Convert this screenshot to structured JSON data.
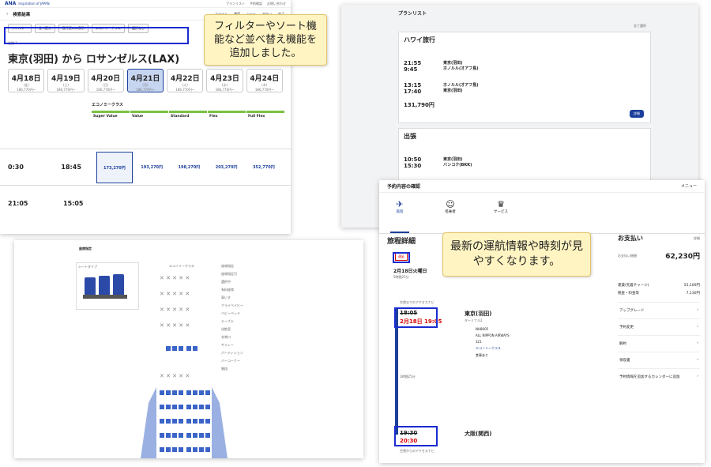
{
  "callouts": {
    "top": "フィルターやソート機能など並べ替え機能を追加しました。",
    "right": "最新の運航情報や時刻が見やすくなります。"
  },
  "search": {
    "brand": "ANA",
    "tagline": "Inspiration of JAPAN",
    "header_links": [
      "プランリスト",
      "予約確認",
      "お問い合わせ"
    ],
    "title": "検索結果",
    "steps": [
      "フライト",
      "運賃",
      "シート",
      "支払い",
      "完了"
    ],
    "filters": [
      "フィルター",
      "並べ替え",
      "直行便のみ表示",
      "エコノミークラス",
      "選択なし"
    ],
    "outbound": "往路 1",
    "route": "東京(羽田) から ロサンゼルス(LAX)",
    "dates": [
      {
        "date": "4月18日",
        "dow": "(金)",
        "price": "186,770円~"
      },
      {
        "date": "4月19日",
        "dow": "(土)",
        "price": "186,770円~"
      },
      {
        "date": "4月20日",
        "dow": "(日)",
        "price": "186,770円~"
      },
      {
        "date": "4月21日",
        "dow": "(月)",
        "price": "186,770円~"
      },
      {
        "date": "4月22日",
        "dow": "(火)",
        "price": "186,770円~"
      },
      {
        "date": "4月23日",
        "dow": "(水)",
        "price": "186,770円~"
      },
      {
        "date": "4月24日",
        "dow": "(木)",
        "price": "186,770円~"
      }
    ],
    "cabin": "エコノミークラス",
    "fare_types": [
      "Super Value",
      "Value",
      "Standard",
      "Flex",
      "Full Flex"
    ],
    "flights": [
      {
        "dep": "0:30",
        "arr": "18:45",
        "prices": [
          "173,270円",
          "193,270円",
          "198,270円",
          "203,270円",
          "352,770円"
        ]
      },
      {
        "dep": "21:05",
        "arr": "15:05",
        "prices": [
          "",
          "",
          "",
          "",
          ""
        ]
      }
    ]
  },
  "plan": {
    "title": "プランリスト",
    "show_all": "全て選択",
    "cards": [
      {
        "name": "ハワイ旅行",
        "dep1": "21:55",
        "arr1": "9:45",
        "from1": "東京(羽田)",
        "to1": "ホノルル(オアフ島)",
        "dep2": "13:15",
        "arr2": "17:40",
        "from2": "ホノルル(オアフ島)",
        "to2": "東京(羽田)",
        "price": "131,790円",
        "button": "詳細"
      },
      {
        "name": "出張",
        "dep1": "10:50",
        "arr1": "15:30",
        "from1": "東京(羽田)",
        "to1": "バンコク(BKK)"
      }
    ]
  },
  "seatmap": {
    "title": "座席指定",
    "seat_type": "シートタイプ",
    "cabin": "エコノミークラス",
    "legend": [
      "座席指定",
      "座席指定可",
      "選択中",
      "有料座席",
      "車いす",
      "クライベイビー",
      "ベビーベッド",
      "テーブル",
      "化粧室",
      "非常口",
      "ギャレー",
      "パーティション",
      "バーコーナー",
      "階段"
    ]
  },
  "booking": {
    "header": "予約内容の確認",
    "menu": "メニュー",
    "tabs": [
      "旅程",
      "搭乗者",
      "サービス"
    ],
    "section": "旅程詳細",
    "status": "遅延",
    "date": "2月18日火曜日",
    "duration": "5時間25分",
    "access_before": "空港までのアクセスナビ",
    "dep_time_old": "18:05",
    "dep_time_new": "2月18日 19:05",
    "dep_airport": "東京(羽田)",
    "terminal": "ターミナル2",
    "flight_no": "NH8005",
    "airline": "ALL NIPPON AIRWAYS",
    "aircraft": "321",
    "class": "エコノミークラス",
    "meal": "食事あり",
    "flight_time": "1時間25分",
    "arr_time_old": "19:30",
    "arr_time_new": "20:30",
    "arr_airport": "大阪(関西)",
    "access_after": "空港からのアクセスナビ",
    "payment_title": "お支払い",
    "detail": "詳細",
    "total_label": "お支払い総額",
    "total": "62,230円",
    "fare_label": "運賃(先着チャージ)",
    "fare": "55,100円",
    "tax_label": "税金・料金等",
    "tax": "7,130円",
    "links": [
      "アップグレード",
      "予約変更",
      "解約",
      "領収書",
      "予約情報を追加するカレンダーに追加"
    ]
  }
}
